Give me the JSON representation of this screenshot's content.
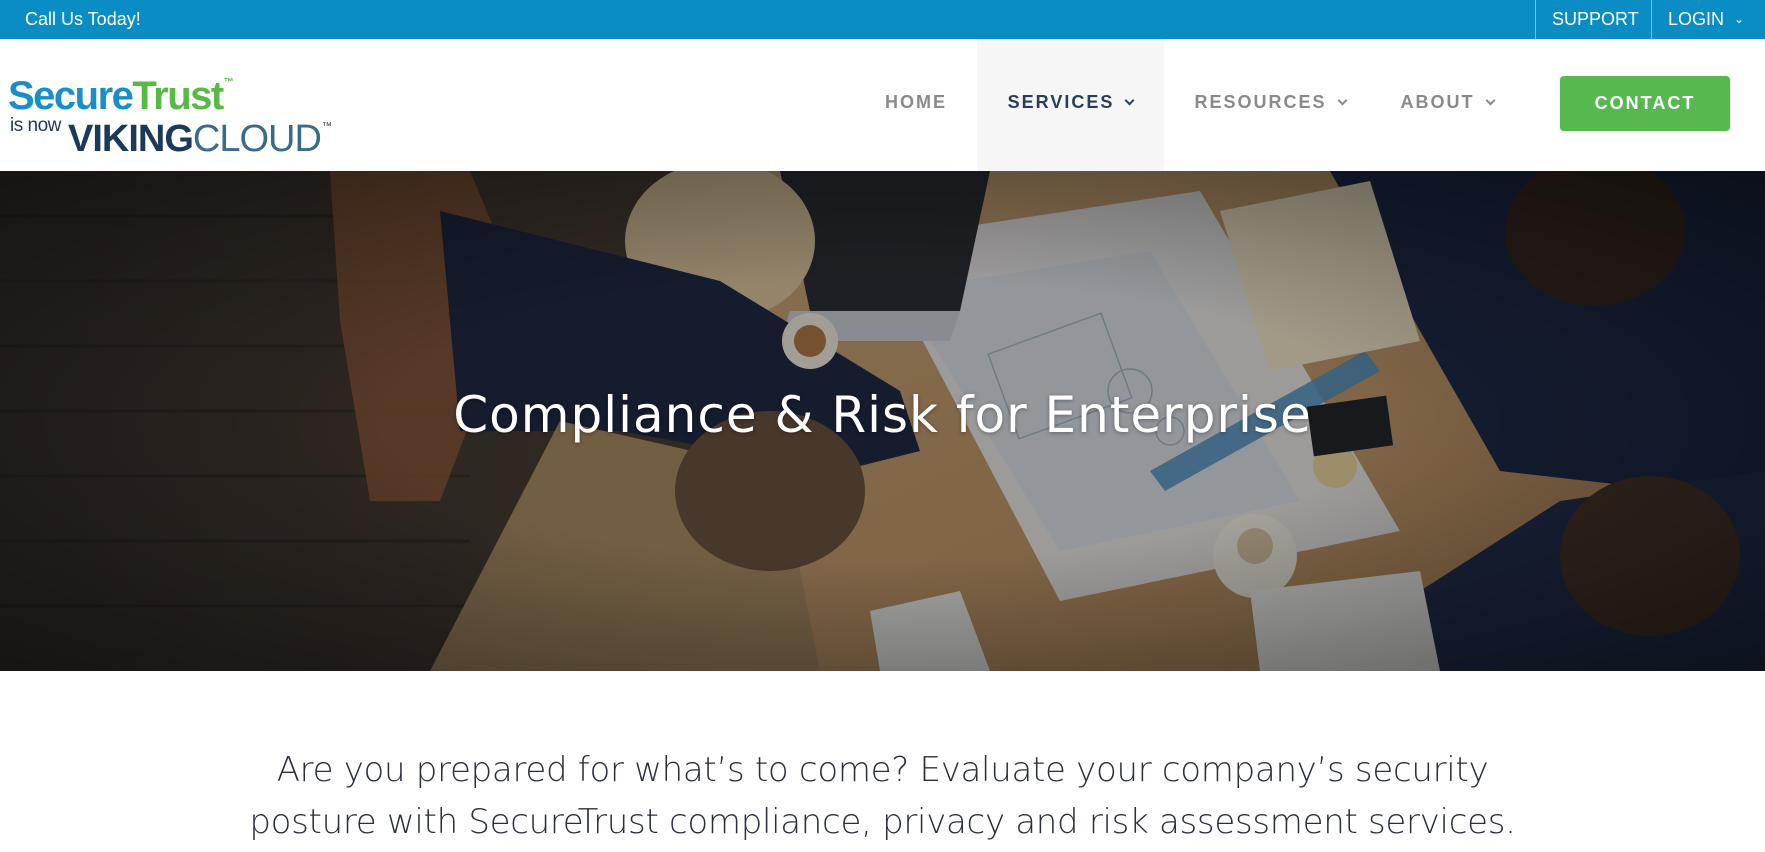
{
  "topbar": {
    "call_text": "Call Us Today!",
    "support_label": "SUPPORT",
    "login_label": "LOGIN"
  },
  "logo": {
    "secure": "Secure",
    "trust": "Trust",
    "tm": "™",
    "is_now": "is now",
    "viking": "VIKING",
    "cloud": "CLOUD"
  },
  "nav": {
    "home": "HOME",
    "services": "SERVICES",
    "resources": "RESOURCES",
    "about": "ABOUT",
    "active": "SERVICES",
    "contact": "CONTACT"
  },
  "hero": {
    "title": "Compliance & Risk for Enterprise"
  },
  "intro": {
    "text": "Are you prepared for what’s to come? Evaluate your company’s security posture with SecureTrust compliance, privacy and risk assessment services."
  },
  "colors": {
    "topbar": "#0a8dc4",
    "contact": "#56b94f",
    "nav_active": "#2a3f57",
    "nav": "#8a8a8a"
  },
  "icons": {
    "login_caret": "chevron-down-icon",
    "nav_caret": "chevron-down-icon"
  }
}
